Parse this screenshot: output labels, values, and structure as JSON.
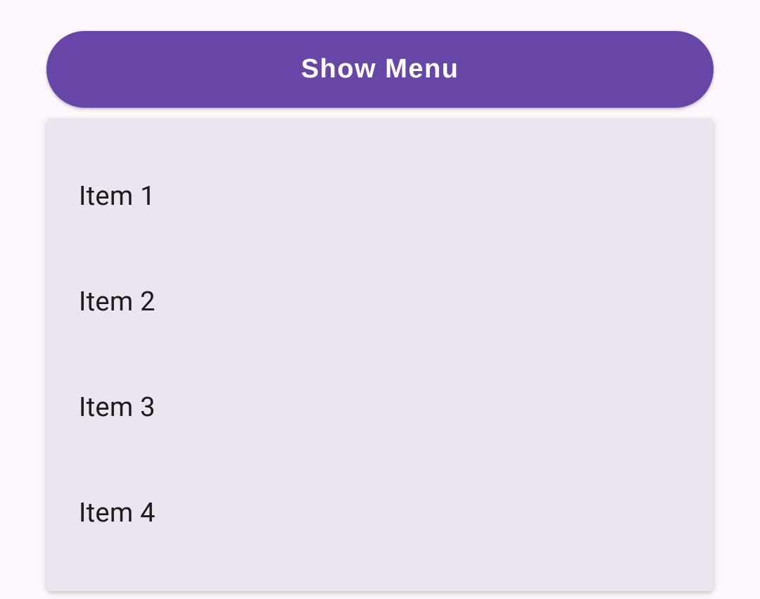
{
  "button": {
    "label": "Show Menu"
  },
  "menu": {
    "items": [
      {
        "label": "Item 1"
      },
      {
        "label": "Item 2"
      },
      {
        "label": "Item 3"
      },
      {
        "label": "Item 4"
      }
    ]
  }
}
